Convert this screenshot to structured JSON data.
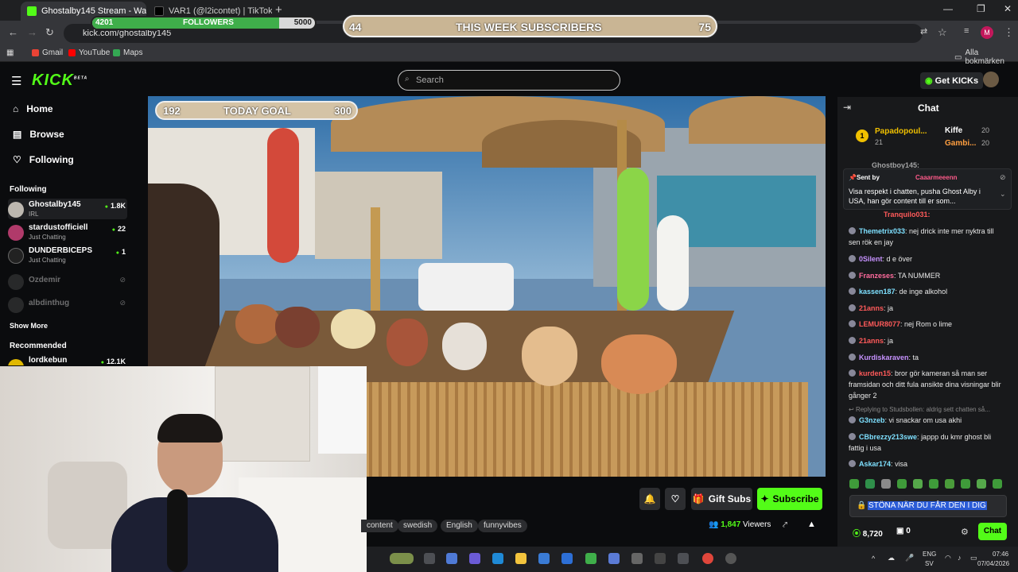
{
  "browser": {
    "tabs": [
      {
        "title": "Ghostalby145 Stream - Wa",
        "active": true
      },
      {
        "title": "VAR1 (@l2icontet) | TikTok",
        "active": false
      }
    ],
    "url": "kick.com/ghostalby145",
    "bookmarks": [
      "Gmail",
      "YouTube",
      "Maps"
    ],
    "all_bookmarks": "Alla bokmärken",
    "profile_initial": "M"
  },
  "overlay": {
    "followers": {
      "current": "4201",
      "label": "FOLLOWERS",
      "target": "5000",
      "progress": 0.84
    },
    "week_subs": {
      "current": "44",
      "label": "THIS WEEK SUBSCRIBERS",
      "target": "75"
    },
    "today_goal": {
      "current": "192",
      "label": "TODAY GOAL",
      "target": "300"
    }
  },
  "kick": {
    "logo": "KICK",
    "logo_badge": "BETA",
    "search_placeholder": "Search",
    "get_kicks": "Get KICKs",
    "nav": [
      "Home",
      "Browse",
      "Following"
    ],
    "following_header": "Following",
    "following": [
      {
        "name": "Ghostalby145",
        "category": "IRL",
        "viewers": "1.8K",
        "live": true
      },
      {
        "name": "stardustofficiell",
        "category": "Just Chatting",
        "viewers": "22",
        "live": true
      },
      {
        "name": "DUNDERBICEPS",
        "category": "Just Chatting",
        "viewers": "1",
        "live": true
      },
      {
        "name": "Ozdemir",
        "category": "",
        "viewers": "",
        "live": false
      },
      {
        "name": "albdinthug",
        "category": "",
        "viewers": "",
        "live": false
      }
    ],
    "show_more": "Show More",
    "recommended_header": "Recommended",
    "recommended": [
      {
        "name": "lordkebun",
        "viewers": "12.1K"
      }
    ]
  },
  "stream": {
    "gift_subs": "Gift Subs",
    "subscribe": "Subscribe",
    "tags": [
      "content",
      "swedish",
      "English",
      "funnyvibes"
    ],
    "viewers": "1,847",
    "viewers_label": "Viewers"
  },
  "chat": {
    "title": "Chat",
    "leaders": [
      {
        "rank": "1",
        "name": "Papadopoul...",
        "count": "21"
      },
      {
        "name": "Kiffe",
        "count": "20"
      },
      {
        "name": "Gambi...",
        "count": "20"
      }
    ],
    "pinned": {
      "sent_by": "Sent by",
      "user": "Caaarmeeenn",
      "text": "Visa respekt i chatten, pusha Ghost Alby i USA, han gör content till er som..."
    },
    "partial_top": "Ghostboy145:",
    "partial_user": "Tranquilo031:",
    "messages": [
      {
        "user": "Themetrix033",
        "color": "#7ee0ff",
        "text": "nej drick inte mer nyktra till sen rök en jay"
      },
      {
        "user": "0Silent",
        "color": "#c792ff",
        "text": "d e över"
      },
      {
        "user": "Franzeses",
        "color": "#ff6b9d",
        "text": "TA NUMMER"
      },
      {
        "user": "kassen187",
        "color": "#7ee0ff",
        "text": "de inge alkohol"
      },
      {
        "user": "21anns",
        "color": "#ff5a5a",
        "text": "ja"
      },
      {
        "user": "LEMUR8077",
        "color": "#ff5a5a",
        "text": "nej Rom o lime"
      },
      {
        "user": "21anns",
        "color": "#ff5a5a",
        "text": "ja"
      },
      {
        "user": "Kurdiskaraven",
        "color": "#c792ff",
        "text": "ta"
      },
      {
        "user": "kurden15",
        "color": "#ff5a5a",
        "text": "bror gör kameran så man ser framsidan och ditt fula ansikte dina visningar blir gånger 2"
      },
      {
        "user": "G3nzeb",
        "color": "#7ee0ff",
        "text": "vi snackar om usa akhi"
      },
      {
        "user": "CBbrezzy213swe",
        "color": "#7ee0ff",
        "text": "jappp du kmr ghost bli fattig i usa"
      },
      {
        "user": "Askar174",
        "color": "#7ee0ff",
        "text": "visa"
      }
    ],
    "reply_to": "Replying to Studsbollen: aldrig sett chatten så...",
    "input_value": "STÖNA NÄR DU FÅR DEN I DIG",
    "points": "8,720",
    "gifts": "0",
    "send": "Chat"
  },
  "taskbar": {
    "lang": "ENG",
    "region": "SV",
    "time": "07:46",
    "date": "07/04/2026"
  },
  "colors": {
    "kick_green": "#53fc18",
    "bg": "#0b0c0e",
    "chat_bg": "#18191b"
  }
}
